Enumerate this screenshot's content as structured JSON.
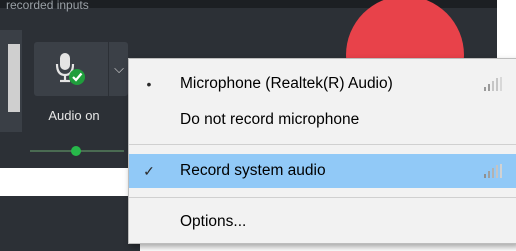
{
  "panel": {
    "title": "recorded inputs",
    "audio_label": "Audio on",
    "dropdown_arrow": "⌵",
    "record_color": "#e8424a",
    "level_color": "#27b84a"
  },
  "menu": {
    "items": [
      {
        "label": "Microphone (Realtek(R) Audio)",
        "mark": "•",
        "selected": false,
        "signal": true
      },
      {
        "label": "Do not record microphone",
        "mark": "",
        "selected": false,
        "signal": false
      },
      {
        "label": "Record system audio",
        "mark": "✓",
        "selected": true,
        "signal": true
      },
      {
        "label": "Options...",
        "mark": "",
        "selected": false,
        "signal": false
      }
    ],
    "highlight_color": "#91c9f7"
  }
}
